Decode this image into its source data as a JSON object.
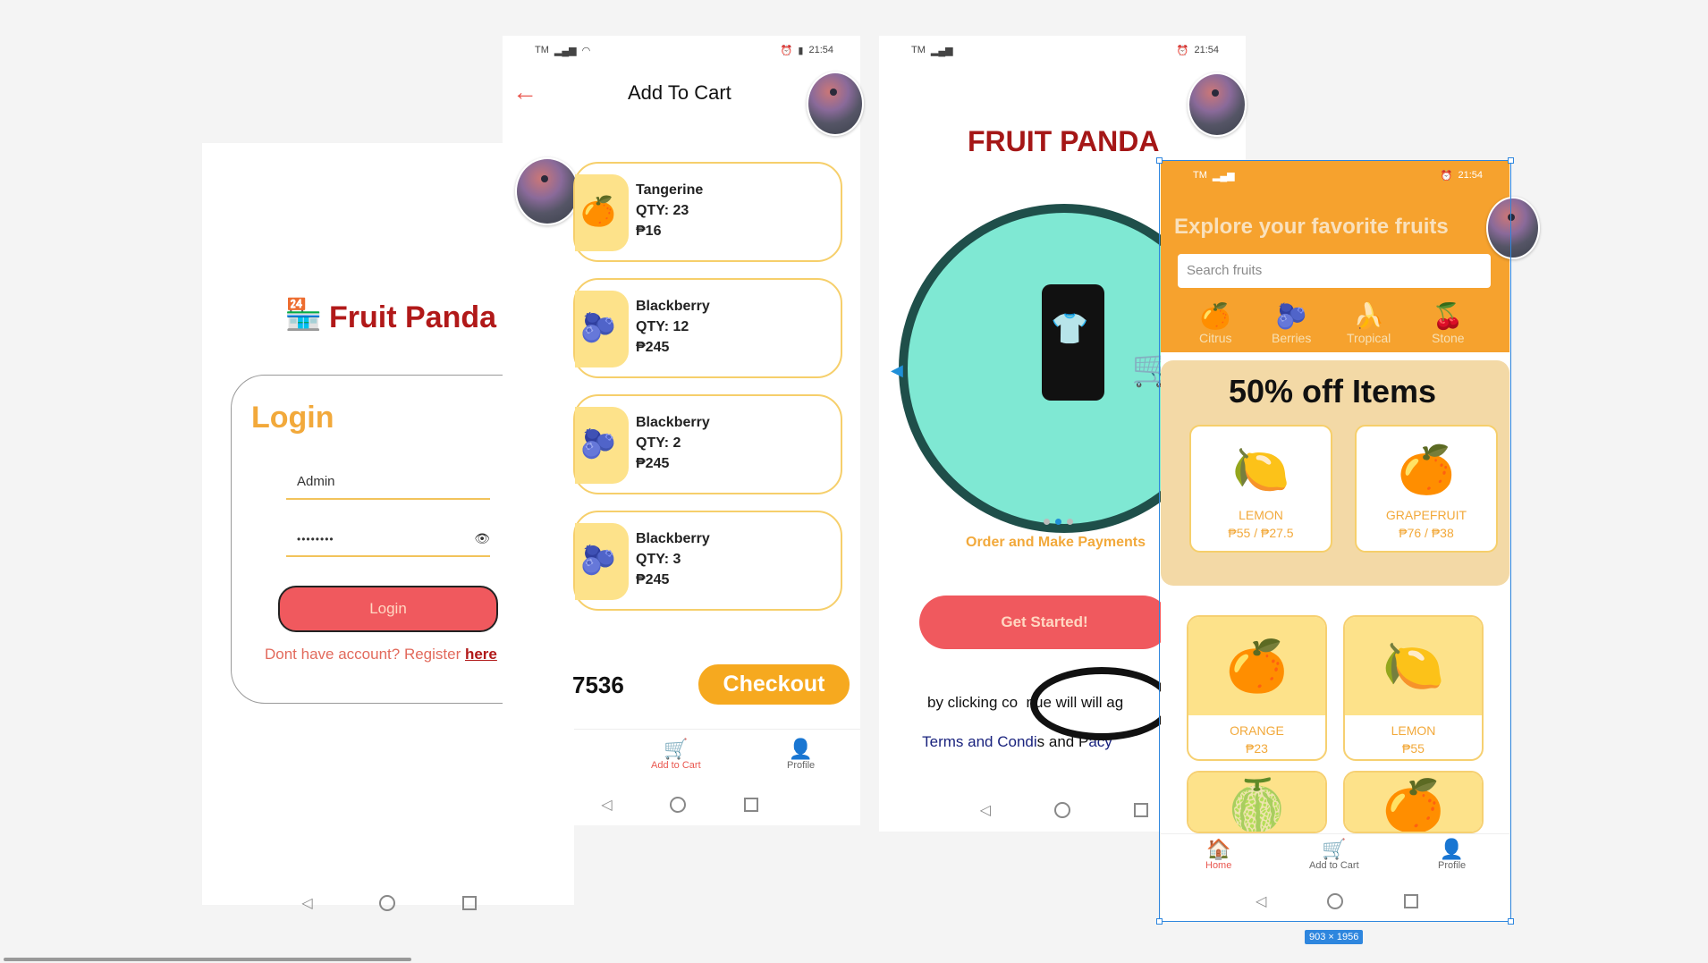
{
  "login_screen": {
    "brand": "Fruit Panda",
    "title": "Login",
    "username_value": "Admin",
    "password_value": "••••••••",
    "login_button": "Login",
    "register_text": "Dont have account? Register ",
    "register_link": "here"
  },
  "cart_screen": {
    "status_left": "TM",
    "status_time": "21:54",
    "title": "Add To Cart",
    "items": [
      {
        "name": "Tangerine",
        "qty": "QTY: 23",
        "price": "₱16",
        "icon": "🍊"
      },
      {
        "name": "Blackberry",
        "qty": "QTY: 12",
        "price": "₱245",
        "icon": "🫐"
      },
      {
        "name": "Blackberry",
        "qty": "QTY: 2",
        "price": "₱245",
        "icon": "🫐"
      },
      {
        "name": "Blackberry",
        "qty": "QTY: 3",
        "price": "₱245",
        "icon": "🫐"
      }
    ],
    "total": "7536",
    "checkout": "Checkout",
    "tabs": {
      "cart": "Add to Cart",
      "profile": "Profile"
    }
  },
  "onboard_screen": {
    "status_left": "TM",
    "status_time": "21:54",
    "title": "FRUIT PANDA",
    "caption": "Order and Make Payments",
    "cta": "Get Started!",
    "terms_line1": "by clicking co  nue will will ag",
    "terms_line2a": "Terms and Condi",
    "terms_line2b": "s and P",
    "terms_line2c": "acy"
  },
  "home_screen": {
    "status_left": "TM",
    "status_time": "21:54",
    "headline": "Explore your favorite fruits",
    "search_placeholder": "Search fruits",
    "categories": [
      {
        "label": "Citrus",
        "icon": "🍊"
      },
      {
        "label": "Berries",
        "icon": "🫐"
      },
      {
        "label": "Tropical",
        "icon": "🍌"
      },
      {
        "label": "Stone",
        "icon": "🍒"
      }
    ],
    "promo_title": "50% off Items",
    "promo_items": [
      {
        "name": "LEMON",
        "price": "₱55 / ₱27.5",
        "icon": "🍋"
      },
      {
        "name": "GRAPEFRUIT",
        "price": "₱76 / ₱38",
        "icon": "🍊"
      }
    ],
    "grid_items": [
      {
        "name": "ORANGE",
        "price": "₱23",
        "icon": "🍊"
      },
      {
        "name": "LEMON",
        "price": "₱55",
        "icon": "🍋"
      },
      {
        "name": "",
        "price": "",
        "icon": "🍈"
      },
      {
        "name": "",
        "price": "",
        "icon": "🍊"
      }
    ],
    "tabs": {
      "home": "Home",
      "cart": "Add to Cart",
      "profile": "Profile"
    },
    "size_badge": "903 × 1956"
  }
}
